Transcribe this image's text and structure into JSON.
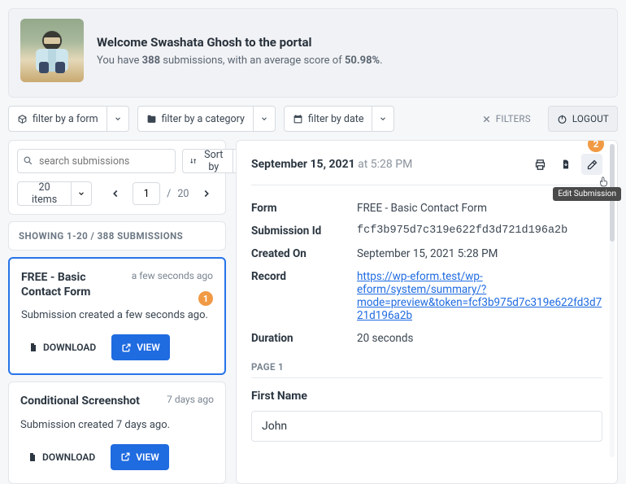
{
  "header": {
    "welcome_prefix": "Welcome ",
    "user_name": "Swashata Ghosh",
    "welcome_suffix": " to the portal",
    "stats_prefix": "You have ",
    "submission_count": "388",
    "stats_mid": " submissions, with an average score of ",
    "avg_score": "50.98%",
    "stats_suffix": "."
  },
  "filters": {
    "by_form": "filter by a form",
    "by_category": "filter by a category",
    "by_date": "filter by date",
    "filters_label": "FILTERS",
    "logout_label": "LOGOUT"
  },
  "sidebar": {
    "search_placeholder": "search submissions",
    "sort_label": "Sort by",
    "items_label": "20 items",
    "page_current": "1",
    "page_sep": "/",
    "page_total": "20",
    "showing_label": "SHOWING 1-20 / 388 SUBMISSIONS",
    "badge1": "1",
    "download_label": "DOWNLOAD",
    "view_label": "VIEW",
    "cards": [
      {
        "title": "FREE - Basic Contact Form",
        "age": "a few seconds ago",
        "body": "Submission created a few seconds ago."
      },
      {
        "title": "Conditional Screenshot",
        "age": "7 days ago",
        "body": "Submission created 7 days ago."
      }
    ]
  },
  "detail": {
    "badge": "2",
    "date_strong": "September 15, 2021",
    "date_at": " at ",
    "date_time": "5:28 PM",
    "tooltip": "Edit Submission",
    "meta": {
      "form_key": "Form",
      "form_val": "FREE - Basic Contact Form",
      "id_key": "Submission Id",
      "id_val": "fcf3b975d7c319e622fd3d721d196a2b",
      "created_key": "Created On",
      "created_val": "September 15, 2021 5:28 PM",
      "record_key": "Record",
      "record_val": "https://wp-eform.test/wp-eform/system/summary/?mode=preview&token=fcf3b975d7c319e622fd3d721d196a2b",
      "duration_key": "Duration",
      "duration_val": "20 seconds"
    },
    "page_label": "PAGE 1",
    "field_label": "First Name",
    "field_value": "John"
  }
}
